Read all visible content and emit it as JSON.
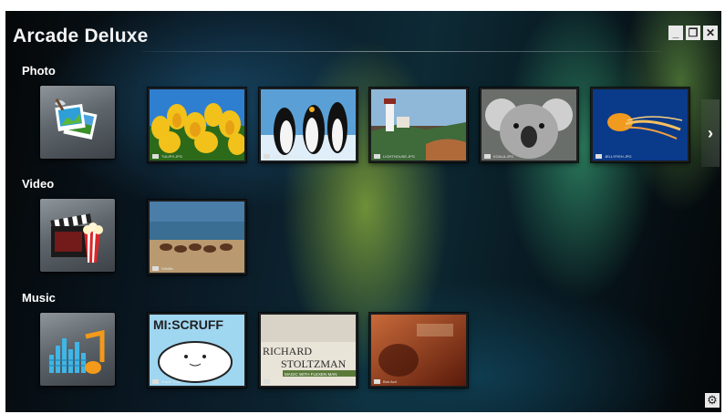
{
  "app": {
    "title": "Arcade Deluxe"
  },
  "window_controls": {
    "minimize": "_",
    "restore": "❐",
    "close": "✕"
  },
  "sections": [
    {
      "label": "Photo",
      "icon": "photo-icon",
      "items": [
        {
          "caption": "TULIPS.JPG",
          "icon": "image-icon"
        },
        {
          "caption": "PENGUINS.JPG",
          "icon": "image-icon"
        },
        {
          "caption": "LIGHTHOUSE.JPG",
          "icon": "image-icon"
        },
        {
          "caption": "KOALA.JPG",
          "icon": "image-icon"
        },
        {
          "caption": "JELLYFISH.JPG",
          "icon": "image-icon"
        }
      ]
    },
    {
      "label": "Video",
      "icon": "video-icon",
      "items": [
        {
          "caption": "Wildlife",
          "icon": "video-file-icon"
        }
      ]
    },
    {
      "label": "Music",
      "icon": "music-icon",
      "items": [
        {
          "caption": "Maple Tune",
          "icon": "music-note-icon"
        },
        {
          "caption": "Fine Music, Vol. 1",
          "icon": "music-note-icon"
        },
        {
          "caption": "Bob Acri",
          "icon": "music-note-icon"
        }
      ]
    }
  ],
  "album_art": {
    "maple_text": "MI:SCRUFF",
    "fine_music_text_1": "RICHARD",
    "fine_music_text_2": "STOLTZMAN",
    "fine_music_text_3": "MAGIC WITH FLEXEN MAN"
  },
  "nav": {
    "next": "›"
  },
  "settings": {
    "icon": "gear-icon",
    "glyph": "⚙"
  }
}
